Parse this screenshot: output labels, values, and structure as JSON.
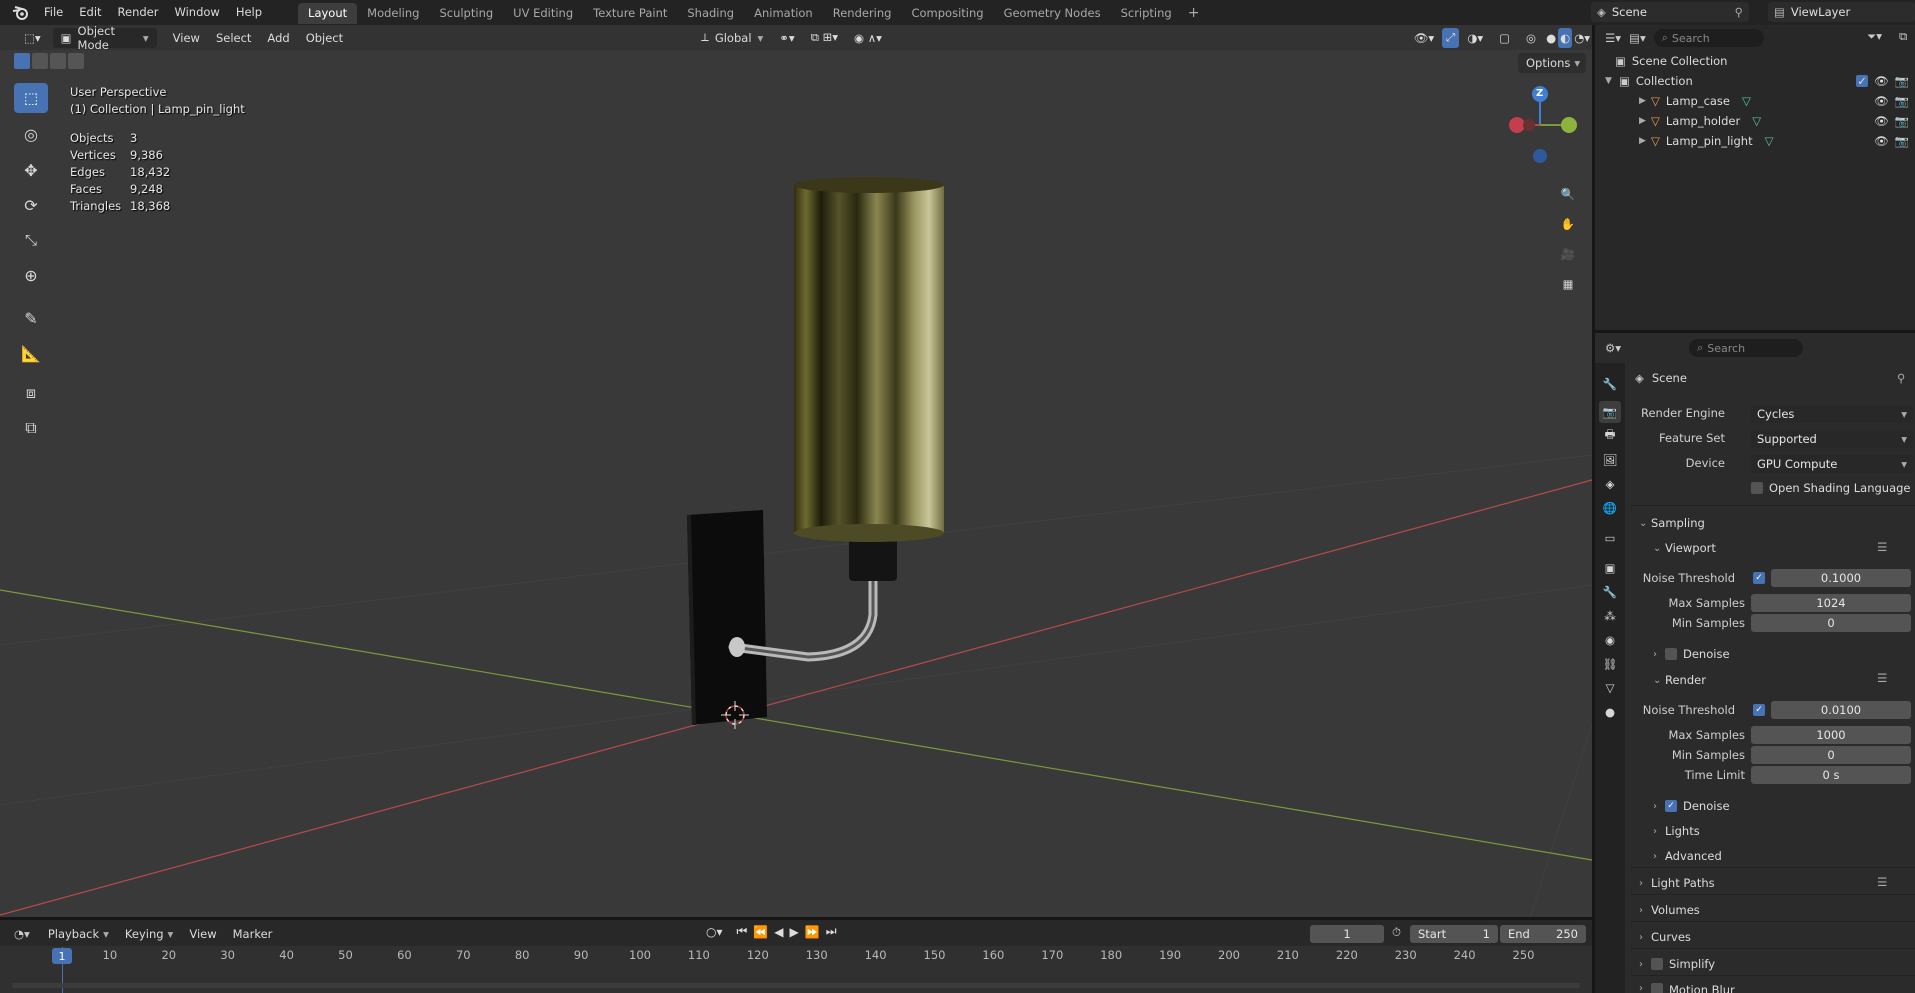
{
  "menu": {
    "items": [
      "File",
      "Edit",
      "Render",
      "Window",
      "Help"
    ]
  },
  "workspaces": {
    "tabs": [
      "Layout",
      "Modeling",
      "Sculpting",
      "UV Editing",
      "Texture Paint",
      "Shading",
      "Animation",
      "Rendering",
      "Compositing",
      "Geometry Nodes",
      "Scripting"
    ],
    "active": "Layout",
    "add": "+"
  },
  "scene_selector": {
    "scene": "Scene",
    "view_layer": "ViewLayer"
  },
  "viewport_header": {
    "mode": "Object Mode",
    "view": "View",
    "select": "Select",
    "add": "Add",
    "object": "Object",
    "transform": "Global",
    "options": "Options"
  },
  "viewport_info": {
    "perspective": "User Perspective",
    "collection": "(1) Collection | Lamp_pin_light"
  },
  "stats": [
    {
      "label": "Objects",
      "value": "3"
    },
    {
      "label": "Vertices",
      "value": "9,386"
    },
    {
      "label": "Edges",
      "value": "18,432"
    },
    {
      "label": "Faces",
      "value": "9,248"
    },
    {
      "label": "Triangles",
      "value": "18,368"
    }
  ],
  "gizmo": {
    "z": "Z"
  },
  "outliner": {
    "search_placeholder": "Search",
    "root": "Scene Collection",
    "collection": "Collection",
    "objects": [
      "Lamp_case",
      "Lamp_holder",
      "Lamp_pin_light"
    ]
  },
  "properties": {
    "search_placeholder": "Search",
    "context": "Scene",
    "render_engine_label": "Render Engine",
    "render_engine": "Cycles",
    "feature_set_label": "Feature Set",
    "feature_set": "Supported",
    "device_label": "Device",
    "device": "GPU Compute",
    "osl_label": "Open Shading Language",
    "sampling": "Sampling",
    "viewport": "Viewport",
    "vp_noise_label": "Noise Threshold",
    "vp_noise": "0.1000",
    "vp_max_label": "Max Samples",
    "vp_max": "1024",
    "vp_min_label": "Min Samples",
    "vp_min": "0",
    "vp_denoise": "Denoise",
    "render": "Render",
    "r_noise_label": "Noise Threshold",
    "r_noise": "0.0100",
    "r_max_label": "Max Samples",
    "r_max": "1000",
    "r_min_label": "Min Samples",
    "r_min": "0",
    "r_time_label": "Time Limit",
    "r_time": "0 s",
    "r_denoise": "Denoise",
    "lights": "Lights",
    "advanced": "Advanced",
    "light_paths": "Light Paths",
    "volumes": "Volumes",
    "curves": "Curves",
    "simplify": "Simplify",
    "motion_blur": "Motion Blur"
  },
  "timeline": {
    "playback": "Playback",
    "keying": "Keying",
    "view": "View",
    "marker": "Marker",
    "current_frame": "1",
    "start_label": "Start",
    "start": "1",
    "end_label": "End",
    "end": "250",
    "ruler": [
      "1",
      "10",
      "20",
      "30",
      "40",
      "50",
      "60",
      "70",
      "80",
      "90",
      "100",
      "110",
      "120",
      "130",
      "140",
      "150",
      "160",
      "170",
      "180",
      "190",
      "200",
      "210",
      "220",
      "230",
      "240",
      "250"
    ]
  },
  "colors": {
    "accent": "#4772b3",
    "x_axis": "#b84a4a",
    "y_axis": "#7a9a3a",
    "z_axis": "#3f7fd4"
  }
}
